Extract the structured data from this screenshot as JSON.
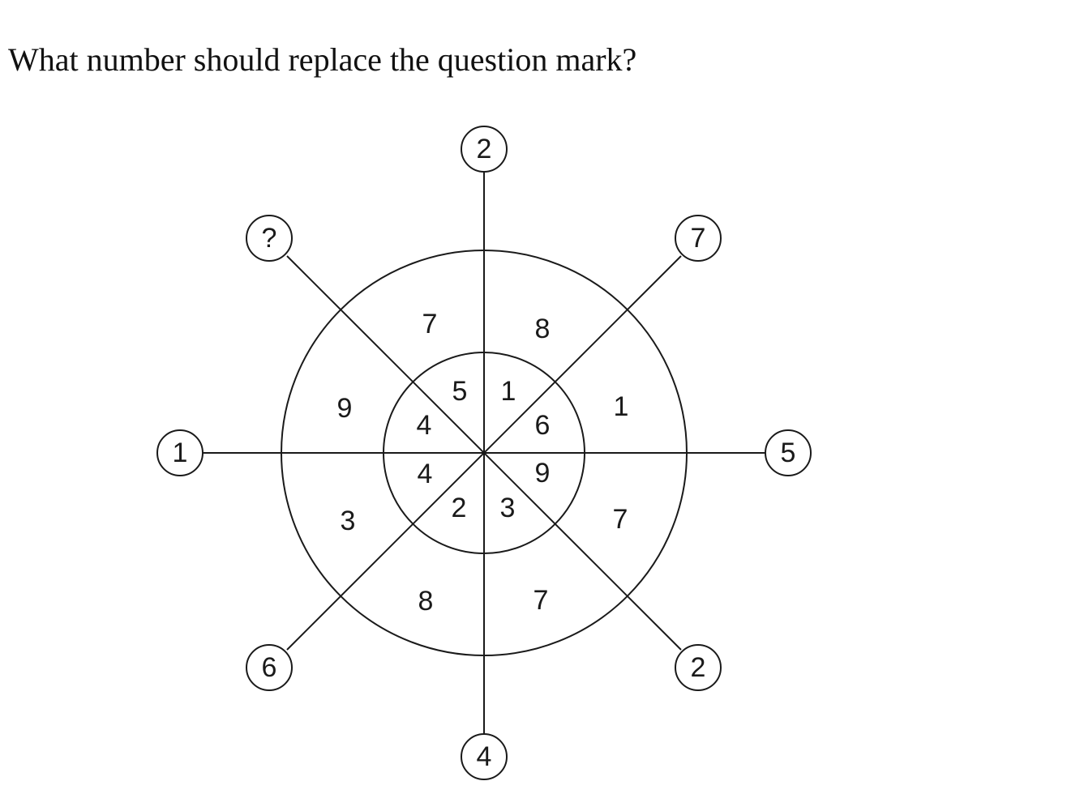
{
  "question": "What number should replace the question mark?",
  "diagram": {
    "outer_bubbles": {
      "top": "2",
      "top_right": "7",
      "right": "5",
      "bottom_right": "2",
      "bottom": "4",
      "bottom_left": "6",
      "left": "1",
      "top_left": "?"
    },
    "outer_ring": {
      "top_left": "7",
      "top_right": "8",
      "right_top": "1",
      "right_bottom": "7",
      "bottom_right": "7",
      "bottom_left": "8",
      "left_bottom": "3",
      "left_top": "9"
    },
    "inner_ring": {
      "top_left": "5",
      "top_right": "1",
      "right_top": "6",
      "right_bottom": "9",
      "bottom_right": "3",
      "bottom_left": "2",
      "left_bottom": "4",
      "left_top": "4"
    }
  }
}
